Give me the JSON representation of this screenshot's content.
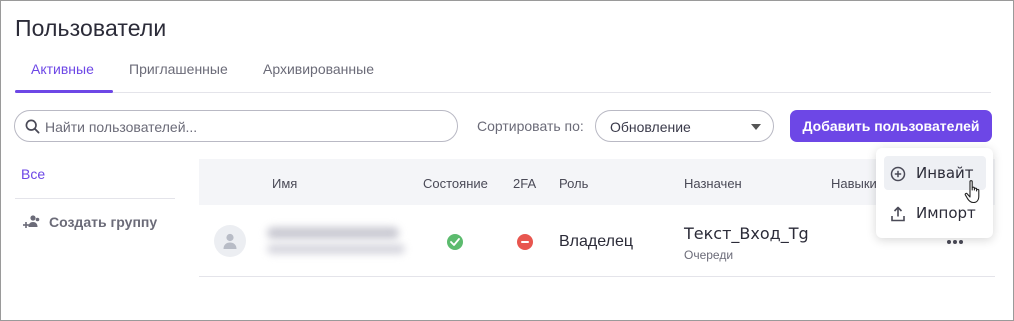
{
  "page": {
    "title": "Пользователи"
  },
  "tabs": [
    {
      "label": "Активные",
      "active": true
    },
    {
      "label": "Приглашенные",
      "active": false
    },
    {
      "label": "Архивированные",
      "active": false
    }
  ],
  "toolbar": {
    "search_placeholder": "Найти пользователей...",
    "sort_label": "Сортировать по:",
    "sort_value": "Обновление",
    "add_button": "Добавить пользователей"
  },
  "groups": {
    "all_label": "Все",
    "create_label": "Создать группу"
  },
  "table": {
    "headers": {
      "name": "Имя",
      "state": "Состояние",
      "twofa": "2FA",
      "role": "Роль",
      "assigned": "Назначен",
      "skills": "Навыки"
    },
    "rows": [
      {
        "role": "Владелец",
        "assigned": "Текст_Вход_Tg",
        "assigned_sub": "Очереди",
        "state_icon": "check-circle-icon",
        "twofa_icon": "minus-circle-icon"
      }
    ]
  },
  "dropdown_menu": {
    "items": [
      {
        "label": "Инвайт",
        "icon": "plus-circle-icon",
        "hovered": true
      },
      {
        "label": "Импорт",
        "icon": "upload-icon",
        "hovered": false
      }
    ]
  },
  "colors": {
    "accent": "#6d47e6",
    "success": "#5cbb6e",
    "danger": "#e8564f",
    "header_bg": "#f4f5f8"
  }
}
